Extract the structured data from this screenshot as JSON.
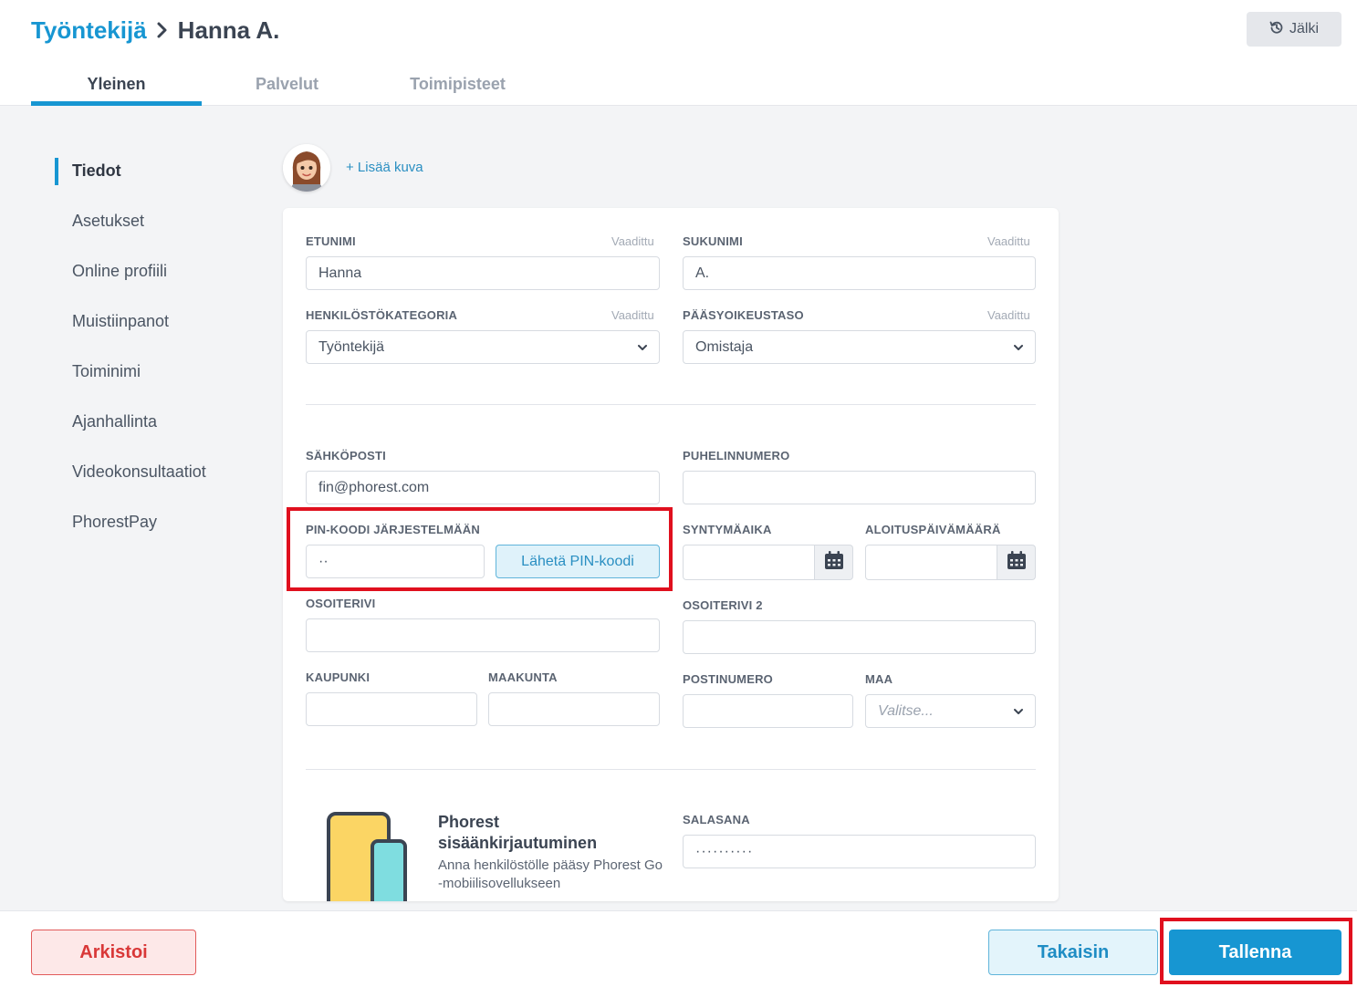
{
  "header": {
    "breadcrumb_parent": "Työntekijä",
    "breadcrumb_current": "Hanna A.",
    "history_label": "Jälki",
    "tabs": [
      {
        "label": "Yleinen",
        "active": true
      },
      {
        "label": "Palvelut",
        "active": false
      },
      {
        "label": "Toimipisteet",
        "active": false
      }
    ]
  },
  "sidenav": {
    "items": [
      {
        "label": "Tiedot",
        "active": true
      },
      {
        "label": "Asetukset"
      },
      {
        "label": "Online profiili"
      },
      {
        "label": "Muistiinpanot"
      },
      {
        "label": "Toiminimi"
      },
      {
        "label": "Ajanhallinta"
      },
      {
        "label": "Videokonsultaatiot"
      },
      {
        "label": "PhorestPay"
      }
    ]
  },
  "profile": {
    "add_photo_label": "+ Lisää kuva"
  },
  "form": {
    "required_label": "Vaadittu",
    "first_name": {
      "label": "ETUNIMI",
      "value": "Hanna"
    },
    "last_name": {
      "label": "SUKUNIMI",
      "value": "A."
    },
    "staff_category": {
      "label": "HENKILÖSTÖKATEGORIA",
      "value": "Työntekijä"
    },
    "access_level": {
      "label": "PÄÄSYOIKEUSTASO",
      "value": "Omistaja"
    },
    "email": {
      "label": "SÄHKÖPOSTI",
      "value": "fin@phorest.com"
    },
    "phone": {
      "label": "PUHELINNUMERO",
      "value": ""
    },
    "pin": {
      "label": "PIN-KOODI JÄRJESTELMÄÄN",
      "value": "··",
      "send_label": "Lähetä PIN-koodi"
    },
    "birth_date": {
      "label": "SYNTYMÄAIKA",
      "value": ""
    },
    "start_date": {
      "label": "ALOITUSPÄIVÄMÄÄRÄ",
      "value": ""
    },
    "address1": {
      "label": "OSOITERIVI",
      "value": ""
    },
    "address2": {
      "label": "OSOITERIVI 2",
      "value": ""
    },
    "city": {
      "label": "KAUPUNKI",
      "value": ""
    },
    "region": {
      "label": "MAAKUNTA",
      "value": ""
    },
    "postcode": {
      "label": "POSTINUMERO",
      "value": ""
    },
    "country": {
      "label": "MAA",
      "placeholder": "Valitse..."
    },
    "login": {
      "title": "Phorest sisäänkirjautuminen",
      "description": "Anna henkilöstölle pääsy Phorest Go -mobiilisovellukseen"
    },
    "password": {
      "label": "SALASANA",
      "value": "··········"
    }
  },
  "footer": {
    "archive_label": "Arkistoi",
    "back_label": "Takaisin",
    "save_label": "Tallenna"
  },
  "colors": {
    "accent": "#1796d2",
    "danger": "#d93838",
    "highlight": "#e0101e"
  }
}
